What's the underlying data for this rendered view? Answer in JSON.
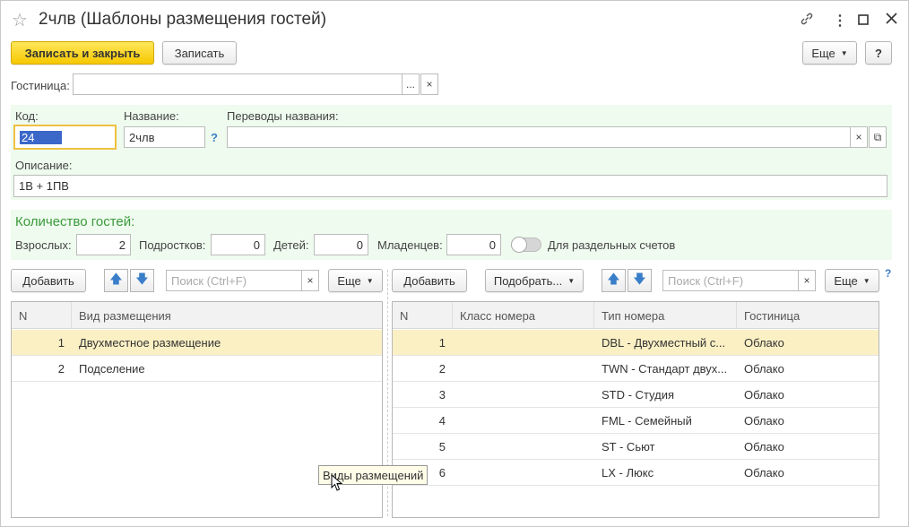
{
  "window": {
    "title": "2члв (Шаблоны размещения гостей)",
    "star_icon": "star-icon",
    "link_icon": "link-icon",
    "more_icon": "vertical-dots-icon",
    "maximize_icon": "maximize-icon",
    "close_icon": "close-icon"
  },
  "toolbar": {
    "save_close_label": "Записать и закрыть",
    "save_label": "Записать",
    "more_label": "Еще",
    "help_label": "?"
  },
  "hotel": {
    "label": "Гостиница:",
    "value": "",
    "select_label": "...",
    "clear_label": "×"
  },
  "fields": {
    "code_label": "Код:",
    "code_value": "24",
    "name_label": "Название:",
    "name_value": "2члв",
    "name_help": "?",
    "translations_label": "Переводы названия:",
    "translations_value": "",
    "translations_clear": "×",
    "translations_open": "⧉",
    "description_label": "Описание:",
    "description_value": "1В + 1ПВ"
  },
  "guests": {
    "title": "Количество гостей:",
    "adults_label": "Взрослых:",
    "adults_value": "2",
    "teens_label": "Подростков:",
    "teens_value": "0",
    "children_label": "Детей:",
    "children_value": "0",
    "infants_label": "Младенцев:",
    "infants_value": "0",
    "separate_bills_label": "Для раздельных счетов",
    "separate_bills_on": false
  },
  "left_panel": {
    "add_label": "Добавить",
    "search_placeholder": "Поиск (Ctrl+F)",
    "search_clear": "×",
    "more_label": "Еще",
    "columns": [
      "N",
      "Вид размещения"
    ],
    "rows": [
      {
        "n": "1",
        "type": "Двухместное размещение",
        "selected": true
      },
      {
        "n": "2",
        "type": "Подселение",
        "selected": false
      }
    ]
  },
  "right_panel": {
    "add_label": "Добавить",
    "pick_label": "Подобрать...",
    "search_placeholder": "Поиск (Ctrl+F)",
    "search_clear": "×",
    "more_label": "Еще",
    "help_label": "?",
    "columns": [
      "N",
      "Класс номера",
      "Тип номера",
      "Гостиница"
    ],
    "rows": [
      {
        "n": "1",
        "class": "",
        "type": "DBL - Двухместный с...",
        "hotel": "Облако",
        "selected": true
      },
      {
        "n": "2",
        "class": "",
        "type": "TWN - Стандарт двух...",
        "hotel": "Облако",
        "selected": false
      },
      {
        "n": "3",
        "class": "",
        "type": "STD - Студия",
        "hotel": "Облако",
        "selected": false
      },
      {
        "n": "4",
        "class": "",
        "type": "FML - Семейный",
        "hotel": "Облако",
        "selected": false
      },
      {
        "n": "5",
        "class": "",
        "type": "ST - Сьют",
        "hotel": "Облако",
        "selected": false
      },
      {
        "n": "6",
        "class": "",
        "type": "LX - Люкс",
        "hotel": "Облако",
        "selected": false
      }
    ]
  },
  "tooltip": {
    "text": "Виды размещений"
  },
  "colors": {
    "accent_yellow": "#f6c800",
    "selected_row": "#fbf0c4",
    "section_green": "#3c9a3c",
    "green_background": "#eefbee",
    "arrow_blue": "#3a7ec9"
  }
}
